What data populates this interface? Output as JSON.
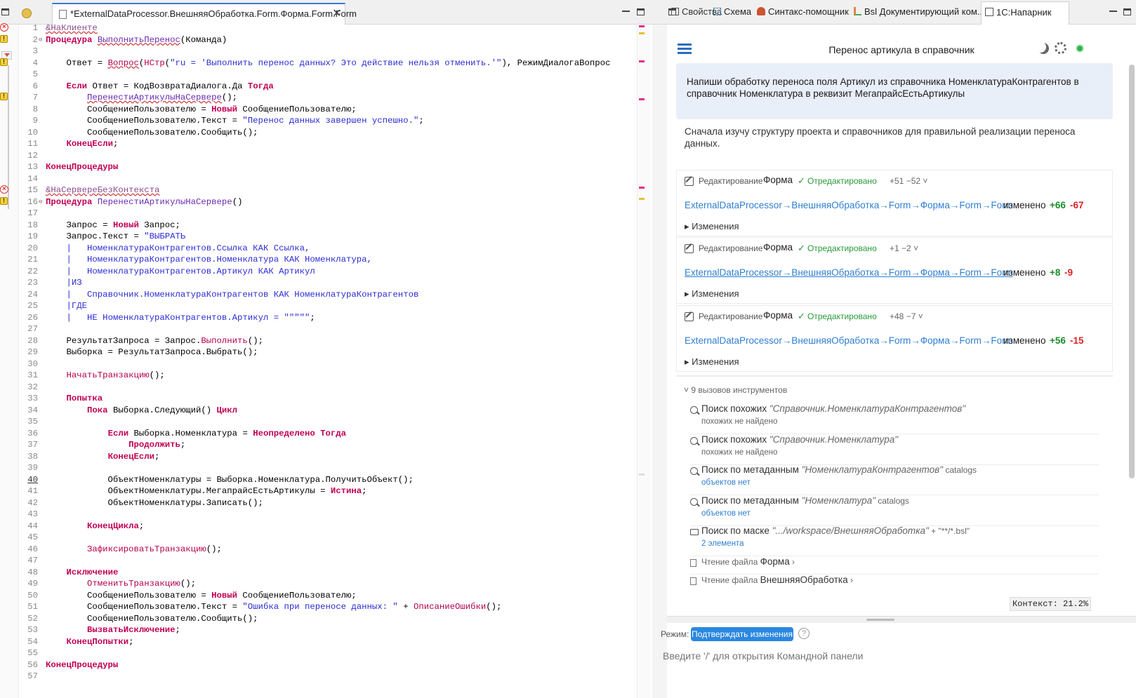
{
  "editor": {
    "tab_title": "*ExternalDataProcessor.ВнешняяОбработка.Form.Форма.Form.Form",
    "tab_close": "✕",
    "lines": [
      {
        "n": "1",
        "mark": "err",
        "code": "<span class='pre'>&amp;НаКлиенте</span>"
      },
      {
        "n": "2",
        "mark": "warn",
        "fold": "⊖",
        "code": "<span class='kw'>Процедура</span> <span class='fn' style='text-decoration:underline wavy #c44'>ВыполнитьПеренос</span>(Команда)"
      },
      {
        "n": "3",
        "code": ""
      },
      {
        "n": "4",
        "mark": "warn",
        "code": "    Ответ = <span class='bif' style='text-decoration:underline wavy #c44'>Вопрос</span>(<span class='bif'>НСтр</span>(<span class='str'>\"ru = 'Выполнить перенос данных? Это действие нельзя отменить.'\"</span>), РежимДиалогаВопрос"
      },
      {
        "n": "5",
        "code": ""
      },
      {
        "n": "6",
        "code": "    <span class='kw'>Если</span> Ответ = КодВозвратаДиалога.Да <span class='kw'>Тогда</span>"
      },
      {
        "n": "7",
        "mark": "warn",
        "code": "        <span class='fn' style='text-decoration:underline wavy #c44'>ПеренестиАртикулыНаСервере</span>();"
      },
      {
        "n": "8",
        "code": "        СообщениеПользователю = <span class='kw'>Новый</span> СообщениеПользователю;"
      },
      {
        "n": "9",
        "code": "        СообщениеПользователю.Текст = <span class='str'>\"Перенос данных завершен успешно.\"</span>;"
      },
      {
        "n": "10",
        "code": "        СообщениеПользователю.Сообщить();"
      },
      {
        "n": "11",
        "code": "    <span class='kw'>КонецЕсли</span>;"
      },
      {
        "n": "12",
        "code": ""
      },
      {
        "n": "13",
        "code": "<span class='kw'>КонецПроцедуры</span>"
      },
      {
        "n": "14",
        "code": ""
      },
      {
        "n": "15",
        "mark": "err",
        "code": "<span class='pre'>&amp;НаСервереБезКонтекста</span>"
      },
      {
        "n": "16",
        "mark": "warn",
        "fold": "⊖",
        "code": "<span class='kw'>Процедура</span> <span class='fn'>ПеренестиАртикулыНаСервере</span>()"
      },
      {
        "n": "17",
        "code": ""
      },
      {
        "n": "18",
        "code": "    Запрос = <span class='kw'>Новый</span> Запрос;"
      },
      {
        "n": "19",
        "code": "    Запрос.Текст = <span class='str'>\"ВЫБРАТЬ</span>"
      },
      {
        "n": "20",
        "code": "    <span class='str'>|   НоменклатураКонтрагентов.Ссылка КАК Ссылка,</span>"
      },
      {
        "n": "21",
        "code": "    <span class='str'>|   НоменклатураКонтрагентов.Номенклатура КАК Номенклатура,</span>"
      },
      {
        "n": "22",
        "code": "    <span class='str'>|   НоменклатураКонтрагентов.Артикул КАК Артикул</span>"
      },
      {
        "n": "23",
        "code": "    <span class='str'>|ИЗ</span>"
      },
      {
        "n": "24",
        "code": "    <span class='str'>|   Справочник.НоменклатураКонтрагентов КАК НоменклатураКонтрагентов</span>"
      },
      {
        "n": "25",
        "code": "    <span class='str'>|ГДЕ</span>"
      },
      {
        "n": "26",
        "code": "    <span class='str'>|   НЕ НоменклатураКонтрагентов.Артикул = \"\"\"\"\"</span>;"
      },
      {
        "n": "27",
        "code": ""
      },
      {
        "n": "28",
        "code": "    РезультатЗапроса = Запрос.<span class='bif'>Выполнить</span>();"
      },
      {
        "n": "29",
        "code": "    Выборка = РезультатЗапроса.Выбрать();"
      },
      {
        "n": "30",
        "code": ""
      },
      {
        "n": "31",
        "code": "    <span class='bif'>НачатьТранзакцию</span>();"
      },
      {
        "n": "32",
        "code": ""
      },
      {
        "n": "33",
        "code": "    <span class='kw'>Попытка</span>"
      },
      {
        "n": "34",
        "code": "        <span class='kw'>Пока</span> Выборка.Следующий() <span class='kw'>Цикл</span>"
      },
      {
        "n": "35",
        "code": ""
      },
      {
        "n": "36",
        "code": "            <span class='kw'>Если</span> Выборка.Номенклатура = <span class='kw'>Неопределено</span> <span class='kw'>Тогда</span>"
      },
      {
        "n": "37",
        "code": "                <span class='kw'>Продолжить</span>;"
      },
      {
        "n": "38",
        "code": "            <span class='kw'>КонецЕсли</span>;"
      },
      {
        "n": "39",
        "code": ""
      },
      {
        "n": "40",
        "cur": true,
        "code": "            ОбъектНоменклатуры = Выборка.Номенклатура.ПолучитьОбъект();"
      },
      {
        "n": "41",
        "code": "            ОбъектНоменклатуры.МегапрайсЕстьАртикулы = <span class='kw'>Истина</span>;"
      },
      {
        "n": "42",
        "code": "            ОбъектНоменклатуры.Записать();"
      },
      {
        "n": "43",
        "code": ""
      },
      {
        "n": "44",
        "code": "        <span class='kw'>КонецЦикла</span>;"
      },
      {
        "n": "45",
        "code": ""
      },
      {
        "n": "46",
        "code": "        <span class='bif'>ЗафиксироватьТранзакцию</span>();"
      },
      {
        "n": "47",
        "code": ""
      },
      {
        "n": "48",
        "code": "    <span class='kw'>Исключение</span>"
      },
      {
        "n": "49",
        "code": "        <span class='bif'>ОтменитьТранзакцию</span>();"
      },
      {
        "n": "50",
        "code": "        СообщениеПользователю = <span class='kw'>Новый</span> СообщениеПользователю;"
      },
      {
        "n": "51",
        "code": "        СообщениеПользователю.Текст = <span class='str'>\"Ошибка при переносе данных: \"</span> + <span class='bif'>ОписаниеОшибки</span>();"
      },
      {
        "n": "52",
        "code": "        СообщениеПользователю.Сообщить();"
      },
      {
        "n": "53",
        "code": "        <span class='kw'>ВызватьИсключение</span>;"
      },
      {
        "n": "54",
        "code": "    <span class='kw'>КонецПопытки</span>;"
      },
      {
        "n": "55",
        "code": ""
      },
      {
        "n": "56",
        "code": "<span class='kw'>КонецПроцедуры</span>"
      },
      {
        "n": "57",
        "code": ""
      }
    ]
  },
  "right_tabs": [
    {
      "label": "Свойства",
      "icon": "properties-icon"
    },
    {
      "label": "Схема",
      "icon": "schema-icon"
    },
    {
      "label": "Синтакс-помощник",
      "icon": "syntax-helper-icon"
    },
    {
      "label": "Bsl Документирующий ком...",
      "icon": "bsl-doc-icon"
    },
    {
      "label": "1С:Напарник",
      "icon": "assistant-icon"
    }
  ],
  "panel": {
    "title": "Перенос артикула в справочник",
    "user_message": "Напиши обработку переноса поля Артикул из справочника НоменклатураКонтрагентов в справочник Номенклатура в реквизит МегапрайсЕстьАртикулы",
    "assistant_message": "Сначала изучу структуру проекта и справочников для правильной реализации переноса данных.",
    "edits": [
      {
        "label": "Редактирование",
        "form": "Форма",
        "check": "✓",
        "status": "Отредактировано",
        "diff": "+51 −52 ˅",
        "path": "ExternalDataProcessor→ВнешняяОбработка→Form→Форма→Form→Form",
        "changed": "изменено",
        "plus": "+66",
        "minus": "-67",
        "toggle": "▸ Изменения"
      },
      {
        "label": "Редактирование",
        "form": "Форма",
        "check": "✓",
        "status": "Отредактировано",
        "diff": "+1 −2 ˅",
        "path": "ExternalDataProcessor→ВнешняяОбработка→Form→Форма→Form→Form",
        "changed": "изменено",
        "plus": "+8",
        "minus": "-9",
        "toggle": "▸ Изменения"
      },
      {
        "label": "Редактирование",
        "form": "Форма",
        "check": "✓",
        "status": "Отредактировано",
        "diff": "+48 −7 ˅",
        "path": "ExternalDataProcessor→ВнешняяОбработка→Form→Форма→Form→Form",
        "changed": "изменено",
        "plus": "+56",
        "minus": "-15",
        "toggle": "▸ Изменения"
      }
    ],
    "tools_header": "˅ 9 вызовов инструментов",
    "tools": [
      {
        "icon": "search",
        "title": "Поиск похожих ",
        "q": "\"Справочник.НоменклатураКонтрагентов\"",
        "cat": "",
        "sub": "похожих не найдено",
        "link": false
      },
      {
        "icon": "search",
        "title": "Поиск похожих ",
        "q": "\"Справочник.Номенклатура\"",
        "cat": "",
        "sub": "похожих не найдено",
        "link": false
      },
      {
        "icon": "search",
        "title": "Поиск по метаданным ",
        "q": "\"НоменклатураКонтрагентов\"",
        "cat": " catalogs",
        "sub": "объектов нет",
        "link": true
      },
      {
        "icon": "search",
        "title": "Поиск по метаданным ",
        "q": "\"Номенклатура\"",
        "cat": " catalogs",
        "sub": "объектов нет",
        "link": true
      },
      {
        "icon": "folder",
        "title": "Поиск по маске ",
        "q": "\".../workspace/ВнешняяОбработка\"",
        "cat": " + \"**/*.bsl\"",
        "sub": "2 элемента",
        "link": true
      }
    ],
    "file_reads": [
      {
        "label": "Чтение файла ",
        "name": "Форма",
        "chev": " ›"
      },
      {
        "label": "Чтение файла ",
        "name": "ВнешняяОбработка",
        "chev": " ›"
      }
    ],
    "context": "Контекст: 21.2%",
    "mode_label": "Режим:",
    "mode_button": "Подтверждать изменения",
    "help": "?",
    "input_placeholder": "Введите '/' для открытия Командной панели"
  }
}
